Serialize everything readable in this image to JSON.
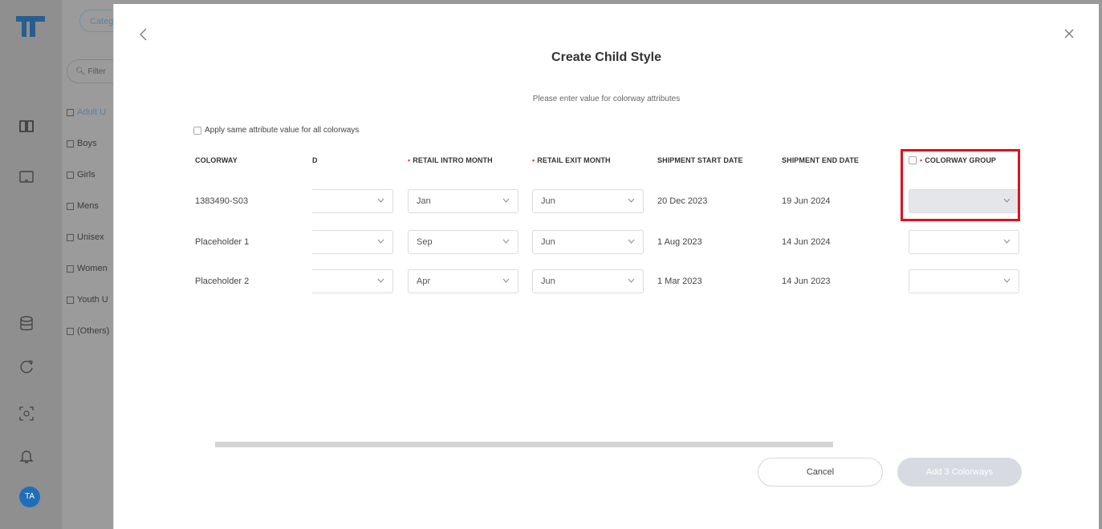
{
  "sidebar": {
    "avatar_initials": "TA"
  },
  "category_panel": {
    "category_button": "Categ",
    "filter_placeholder": "Filter",
    "items": [
      "Adult U",
      "Boys",
      "Girls",
      "Mens",
      "Unisex",
      "Women",
      "Youth U",
      "(Others)"
    ]
  },
  "modal": {
    "title": "Create Child Style",
    "subtitle": "Please enter value for colorway attributes",
    "apply_all_label": "Apply same attribute value for all colorways",
    "columns": {
      "colorway": "COLORWAY",
      "d": "D",
      "retail_intro_month": "RETAIL INTRO MONTH",
      "retail_exit_month": "RETAIL EXIT MONTH",
      "shipment_start_date": "SHIPMENT START DATE",
      "shipment_end_date": "SHIPMENT END DATE",
      "colorway_group": "COLORWAY GROUP"
    },
    "rows": [
      {
        "colorway": "1383490-S03",
        "d": "",
        "intro": "Jan",
        "exit": "Jun",
        "ship_start": "20 Dec 2023",
        "ship_end": "19 Jun 2024",
        "group": ""
      },
      {
        "colorway": "Placeholder 1",
        "d": "",
        "intro": "Sep",
        "exit": "Jun",
        "ship_start": "1 Aug 2023",
        "ship_end": "14 Jun 2024",
        "group": ""
      },
      {
        "colorway": "Placeholder 2",
        "d": "",
        "intro": "Apr",
        "exit": "Jun",
        "ship_start": "1 Mar 2023",
        "ship_end": "14 Jun 2023",
        "group": ""
      }
    ],
    "cancel_label": "Cancel",
    "add_label": "Add 3 Colorways"
  },
  "colors": {
    "required_marker": "#e04040",
    "highlight": "#e0101e",
    "avatar": "#1f6fb8",
    "accent": "#5f7f9c"
  }
}
